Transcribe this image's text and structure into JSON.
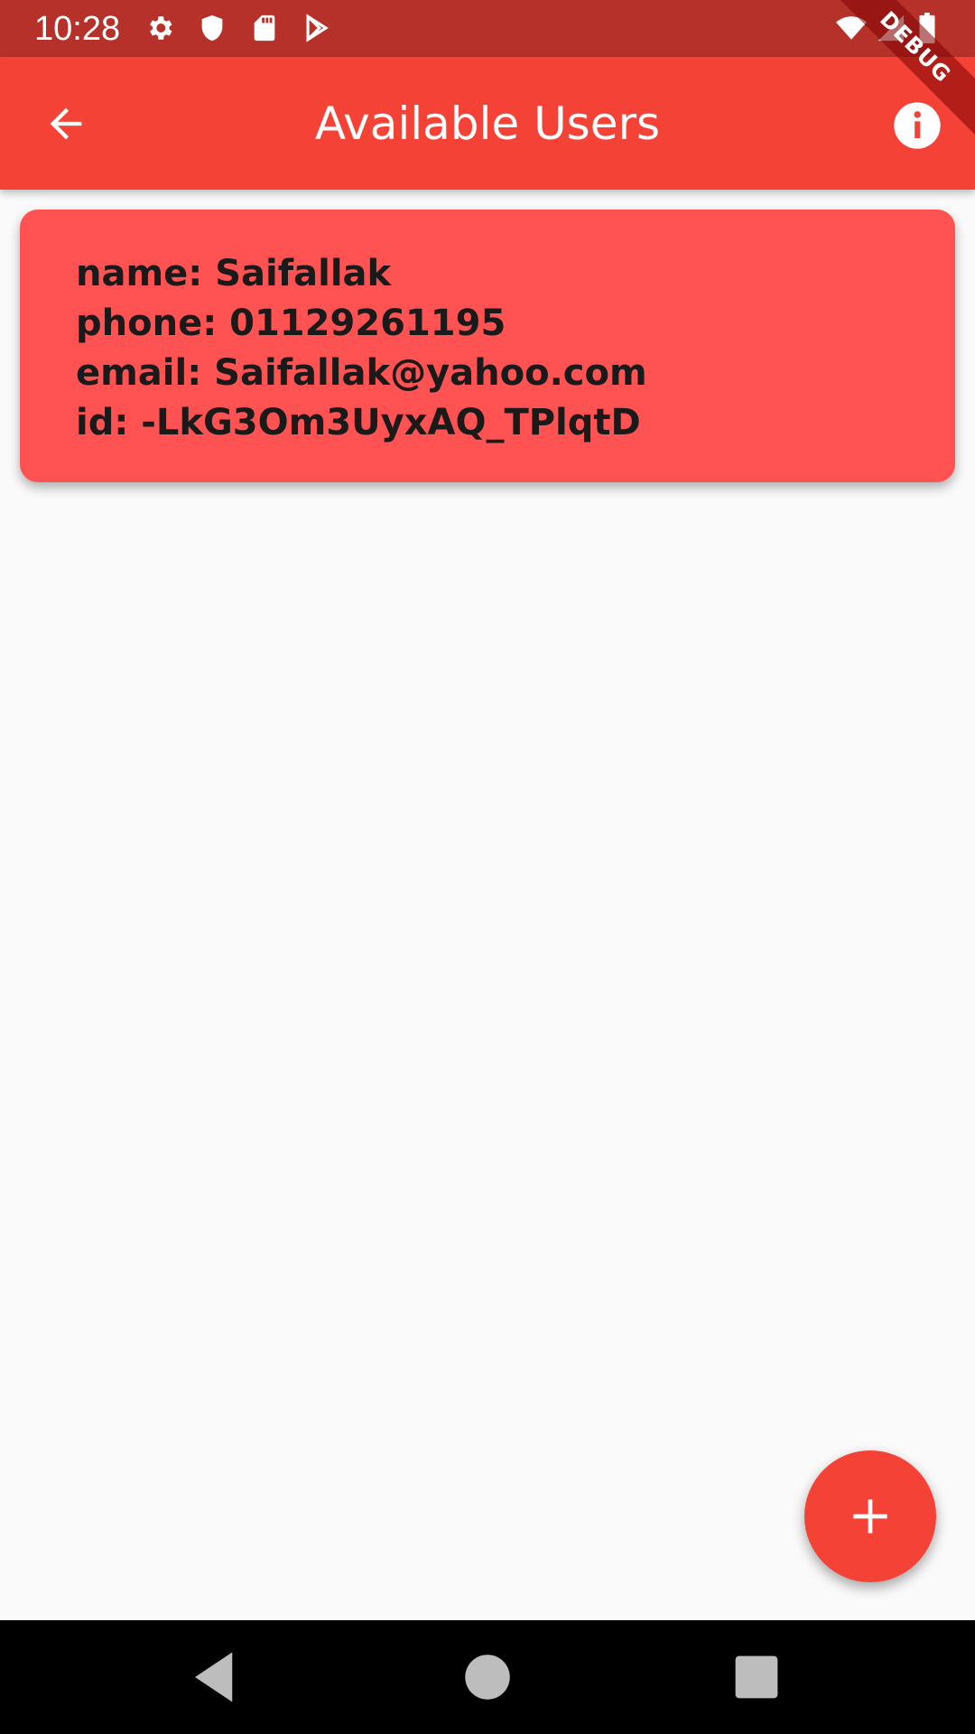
{
  "status_bar": {
    "time": "10:28",
    "icons": [
      "settings-icon",
      "shield-icon",
      "sd-card-icon",
      "play-store-icon",
      "wifi-icon",
      "signal-icon",
      "battery-icon"
    ],
    "background": "#B6312A"
  },
  "debug_banner": {
    "label": "DEBUG"
  },
  "app_bar": {
    "title": "Available Users",
    "back_icon": "arrow-back-icon",
    "info_icon": "info-icon",
    "background": "#F44336"
  },
  "users": [
    {
      "name_line": "name: Saifallak",
      "phone_line": "phone: 01129261195",
      "email_line": "email: Saifallak@yahoo.com",
      "id_line": "id: -LkG3Om3UyxAQ_TPlqtD"
    }
  ],
  "card": {
    "background": "#FF5252"
  },
  "fab": {
    "icon": "add-icon",
    "background": "#F44336"
  },
  "nav_bar": {
    "buttons": [
      "back-triangle-icon",
      "home-circle-icon",
      "recents-square-icon"
    ]
  }
}
